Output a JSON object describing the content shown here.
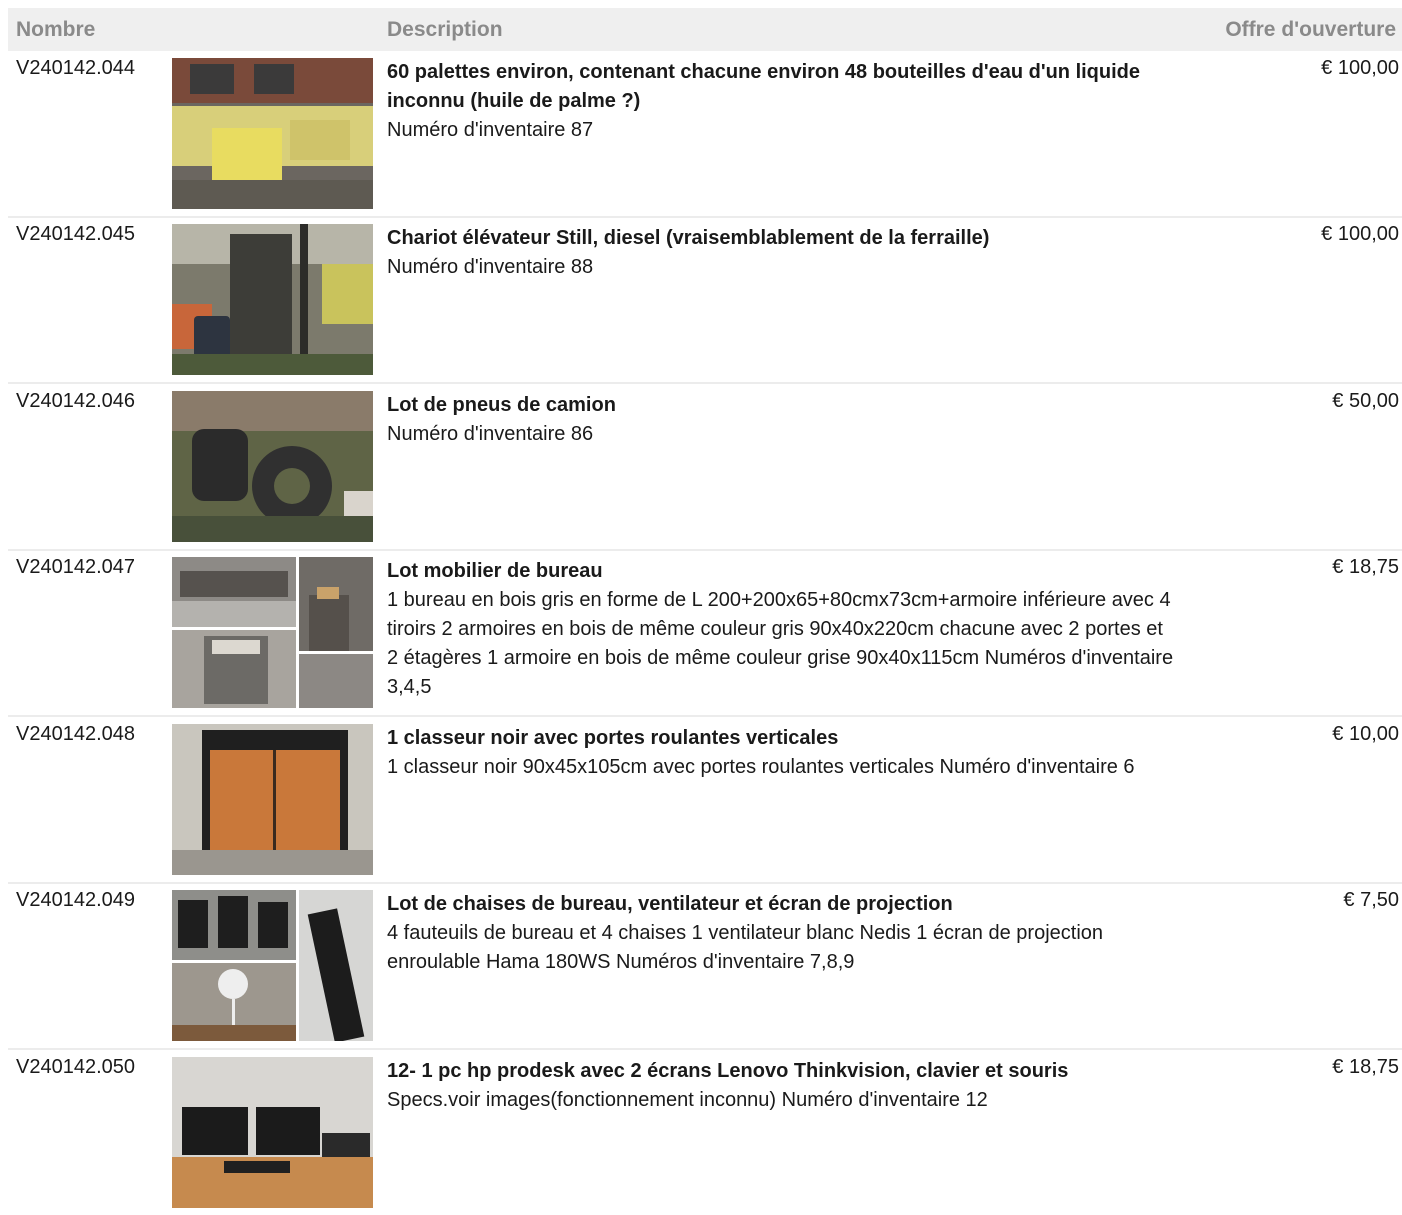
{
  "header": {
    "col_number": "Nombre",
    "col_description": "Description",
    "col_price": "Offre d'ouverture"
  },
  "rows": [
    {
      "lot": "V240142.044",
      "title": "60 palettes environ, contenant chacune environ 48 bouteilles d'eau d'un liquide inconnu (huile de palme ?)",
      "body": "Numéro d'inventaire 87",
      "price": "€ 100,00",
      "image": "pallets-photo"
    },
    {
      "lot": "V240142.045",
      "title": "Chariot élévateur Still, diesel (vraisemblablement de la ferraille)",
      "body": "Numéro d'inventaire 88",
      "price": "€ 100,00",
      "image": "forklift-photo"
    },
    {
      "lot": "V240142.046",
      "title": "Lot de pneus de camion",
      "body": "Numéro d'inventaire 86",
      "price": "€ 50,00",
      "image": "tires-photo"
    },
    {
      "lot": "V240142.047",
      "title": "Lot mobilier de bureau",
      "body": "1 bureau en bois gris en forme de L 200+200x65+80cmx73cm+armoire inférieure avec 4 tiroirs 2 armoires en bois de même couleur gris 90x40x220cm chacune avec 2 portes et 2 étagères 1 armoire en bois de même couleur grise 90x40x115cm Numéros d'inventaire 3,4,5",
      "price": "€ 18,75",
      "image": "office-furniture-collage"
    },
    {
      "lot": "V240142.048",
      "title": "1 classeur noir avec portes roulantes verticales",
      "body": "1 classeur noir 90x45x105cm avec portes roulantes verticales Numéro d'inventaire 6",
      "price": "€ 10,00",
      "image": "cabinet-photo"
    },
    {
      "lot": "V240142.049",
      "title": "Lot de chaises de bureau, ventilateur et écran de projection",
      "body": "4 fauteuils de bureau et 4 chaises 1 ventilateur blanc Nedis 1 écran de projection enroulable Hama 180WS Numéros d'inventaire 7,8,9",
      "price": "€ 7,50",
      "image": "chairs-fan-screen-collage"
    },
    {
      "lot": "V240142.050",
      "title": "12- 1 pc hp prodesk avec 2 écrans Lenovo Thinkvision, clavier et souris",
      "body": "Specs.voir images(fonctionnement inconnu) Numéro d'inventaire 12",
      "price": "€ 18,75",
      "image": "computer-desk-photo"
    }
  ],
  "colors": {
    "header_bg": "#efefef",
    "header_text": "#8a8a8a",
    "row_divider": "#ececec"
  }
}
